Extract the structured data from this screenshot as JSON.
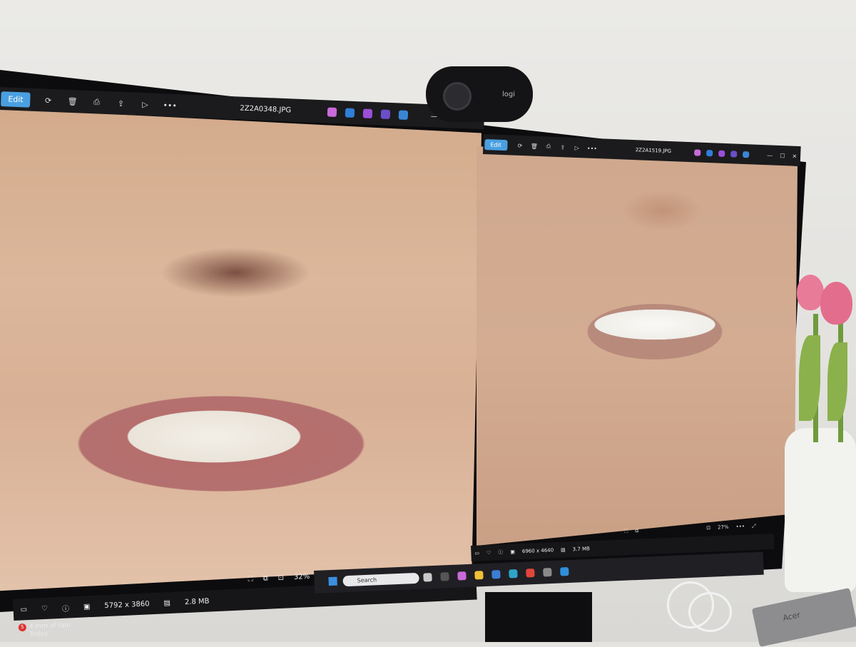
{
  "left_window": {
    "toolbar": {
      "edit_label": "Edit",
      "filename": "2Z2A0348.JPG"
    },
    "status": {
      "dimensions": "5792 x 3860",
      "filesize": "2.8 MB",
      "zoom": "32%"
    }
  },
  "right_window": {
    "toolbar": {
      "edit_label": "Edit",
      "filename": "2Z2A1519.JPG"
    },
    "status": {
      "dimensions": "6960 x 4640",
      "filesize": "3.7 MB",
      "zoom": "27%"
    }
  },
  "taskbar": {
    "search_placeholder": "Search"
  },
  "weather": {
    "badge": "5",
    "text": "4 mm of rain",
    "subtext": "Today"
  },
  "webcam": {
    "brand": "logi"
  },
  "hub": {
    "brand": "Acer"
  },
  "colors": {
    "accent": "#4a9fe0",
    "toolbar_bg": "#1b1b1d"
  }
}
